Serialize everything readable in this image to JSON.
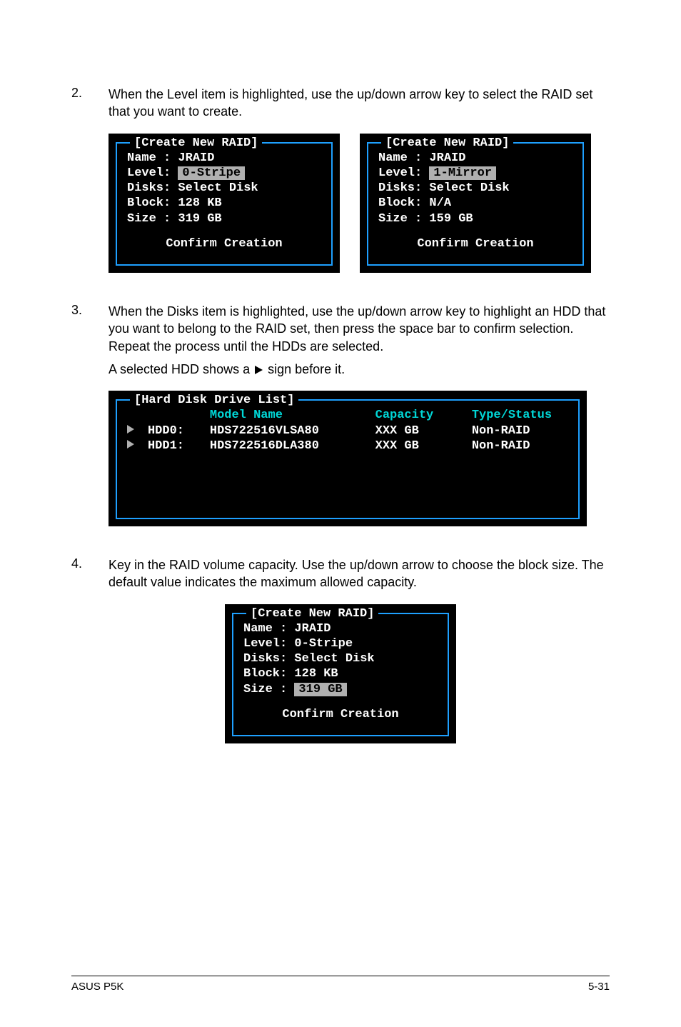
{
  "steps": {
    "s2": {
      "num": "2.",
      "text": "When the Level item is highlighted, use the up/down arrow key to select the RAID set that you want to create."
    },
    "s3": {
      "num": "3.",
      "text": "When the Disks item is highlighted, use the up/down arrow key to highlight an HDD that you want to belong to the RAID set, then press the space bar to confirm selection. Repeat the process until the HDDs are selected.",
      "sub_before": "A selected HDD shows a ",
      "sub_after": " sign before it."
    },
    "s4": {
      "num": "4.",
      "text": "Key in the RAID volume capacity. Use the up/down arrow to choose the block size. The default value indicates the maximum allowed capacity."
    }
  },
  "raidA": {
    "title": "[Create New RAID]",
    "name": "Name : JRAID",
    "level_label": "Level:",
    "level_value": "0-Stripe",
    "disks": "Disks: Select Disk",
    "block": "Block: 128 KB",
    "size": "Size : 319 GB",
    "confirm": "Confirm Creation"
  },
  "raidB": {
    "title": "[Create New RAID]",
    "name": "Name : JRAID",
    "level_label": "Level:",
    "level_value": "1-Mirror",
    "disks": "Disks: Select Disk",
    "block": "Block: N/A",
    "size": "Size : 159 GB",
    "confirm": "Confirm Creation"
  },
  "hdd": {
    "title": "[Hard Disk Drive List]",
    "hdr_model": "Model Name",
    "hdr_cap": "Capacity",
    "hdr_type": "Type/Status",
    "rows": [
      {
        "id": "HDD0:",
        "model": "HDS722516VLSA80",
        "cap": "XXX GB",
        "type": "Non-RAID"
      },
      {
        "id": "HDD1:",
        "model": "HDS722516DLA380",
        "cap": "XXX GB",
        "type": "Non-RAID"
      }
    ]
  },
  "raidC": {
    "title": "[Create New RAID]",
    "name": "Name : JRAID",
    "level": "Level: 0-Stripe",
    "disks": "Disks: Select Disk",
    "block": "Block: 128 KB",
    "size_label": "Size :",
    "size_value": "319 GB",
    "confirm": "Confirm Creation"
  },
  "footer": {
    "left": "ASUS P5K",
    "right": "5-31"
  }
}
